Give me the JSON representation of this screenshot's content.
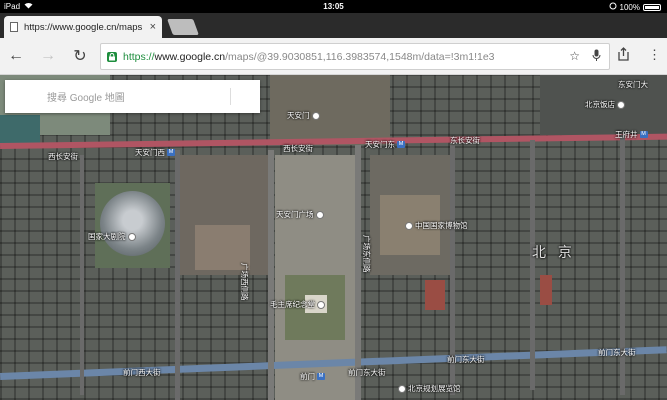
{
  "status_bar": {
    "device": "iPad",
    "time": "13:05",
    "battery": "100%"
  },
  "tab": {
    "title": "https://www.google.cn/maps",
    "close_glyph": "×"
  },
  "toolbar": {
    "back_glyph": "←",
    "forward_glyph": "→",
    "reload_glyph": "↻",
    "url_proto": "https://",
    "url_host": "www.google.cn",
    "url_path": "/maps/@39.9030851,116.3983574,1548m/data=!3m1!1e3",
    "star_glyph": "☆",
    "mic_glyph": "🎤",
    "share_glyph": "⇪",
    "menu_glyph": "⋮"
  },
  "search": {
    "placeholder": "搜尋 Google 地圖"
  },
  "map_labels": {
    "tiananmen": "天安门",
    "donganmen": "东安门大",
    "bjfandian": "北京饭店",
    "wangfujing": "王府井",
    "xichanganjie": "西长安街",
    "tiananmen_west": "天安门西",
    "xichanganjie2": "西长安街",
    "tiananmen_east": "天安门东",
    "dongchanganjie": "东长安街",
    "tiananmen_square": "天安门广场",
    "national_theater": "国家大剧院",
    "national_museum": "中国国家博物馆",
    "beijing": "北 京",
    "square_west_rd": "广场西侧路",
    "square_east_rd": "广场东侧路",
    "mausoleum": "毛主席纪念堂",
    "qianmen_west": "前门西大街",
    "qianmen": "前门",
    "qianmen_east": "前门东大街",
    "qianmen_east2": "前门东大街",
    "qianmen_east3": "前门东大街",
    "planning_hall": "北京规划展览馆",
    "metro_mark": "M"
  },
  "colors": {
    "secure_green": "#1e8e3e",
    "metro_blue": "#3a70c2",
    "chang_an_line": "#b05563"
  }
}
